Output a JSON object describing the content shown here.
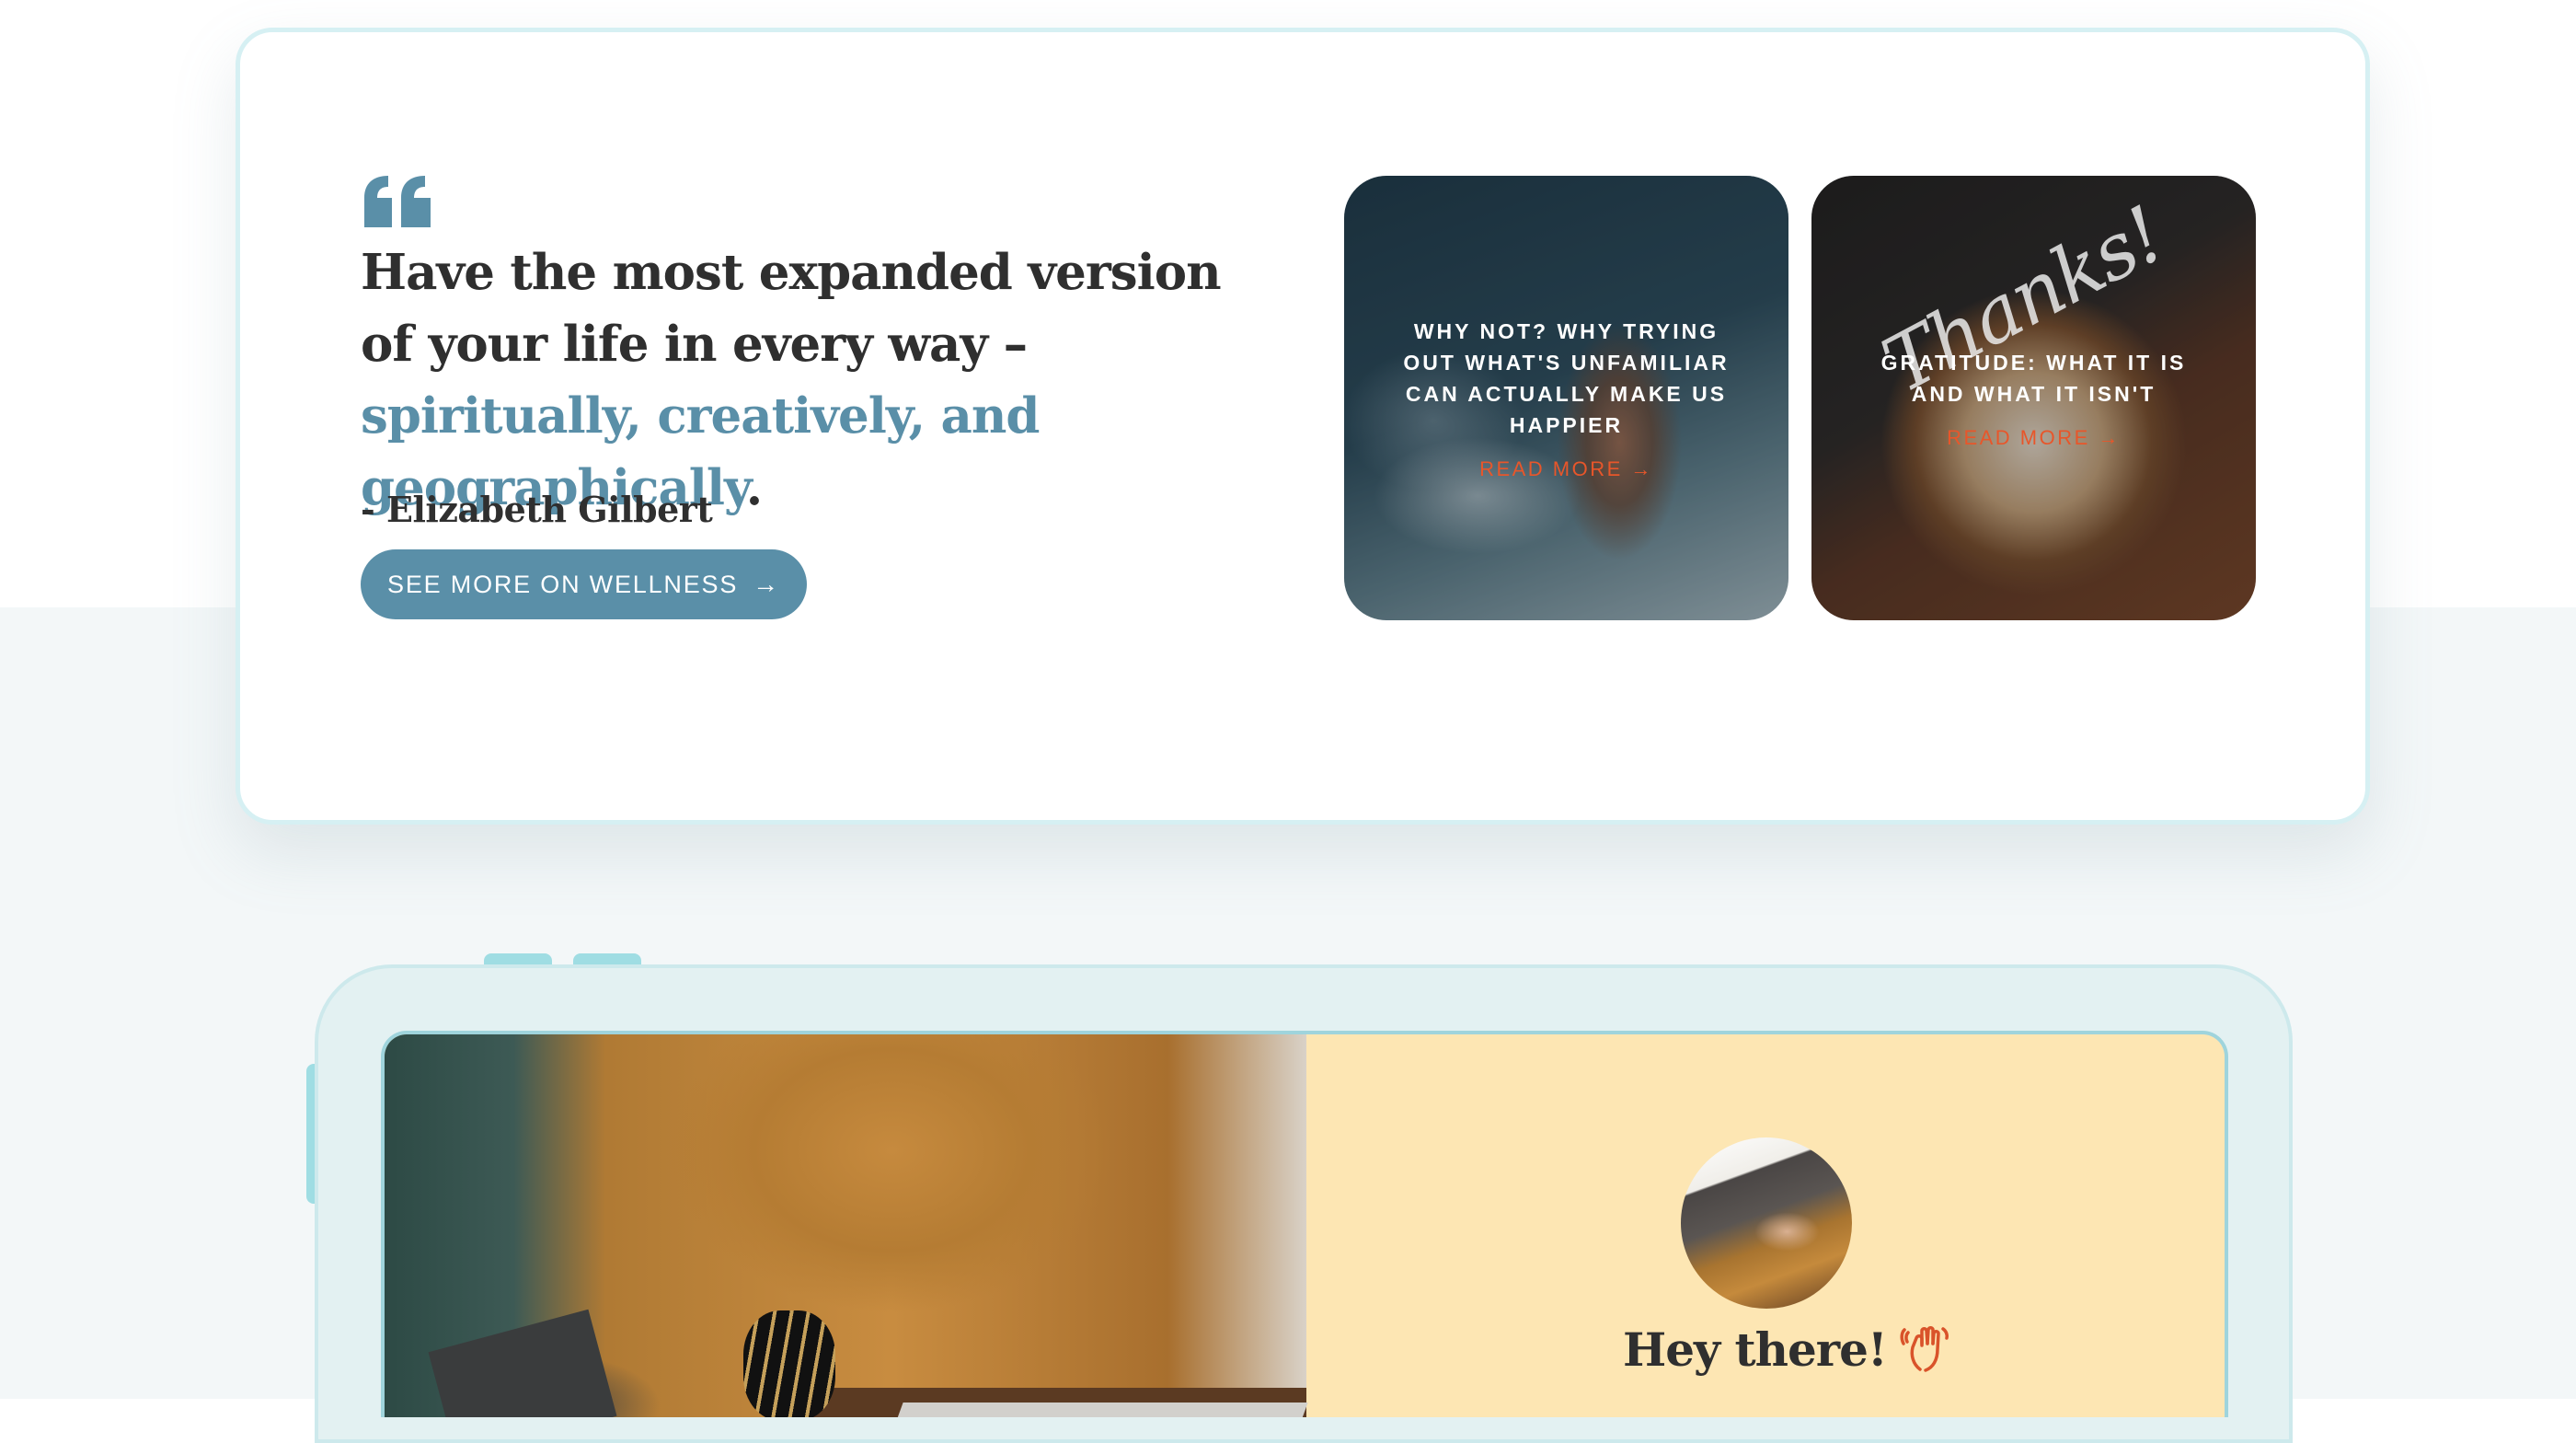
{
  "quote": {
    "text_part1": "Have the most expanded version of your life in every way – ",
    "text_accent": "spiritually, creatively, and geographically",
    "text_end": ".",
    "author": "- Elizabeth Gilbert",
    "button_label": "SEE MORE ON WELLNESS",
    "button_arrow": "→"
  },
  "posts": [
    {
      "title": "WHY NOT? WHY TRYING OUT WHAT'S UNFAMILIAR CAN ACTUALLY MAKE US HAPPIER",
      "read_more": "READ MORE →"
    },
    {
      "title": "GRATITUDE: WHAT IT IS AND WHAT IT ISN'T",
      "read_more": "READ MORE →",
      "image_lettering": "Thanks!"
    }
  ],
  "intro": {
    "greeting": "Hey there!"
  },
  "colors": {
    "accent": "#5a8fa8",
    "read_more": "#e8562a",
    "card_border": "#d6f0f3",
    "intro_bg": "#fde6b3"
  },
  "icons": {
    "quote": "quote-icon",
    "wave": "waving-hand-icon"
  }
}
